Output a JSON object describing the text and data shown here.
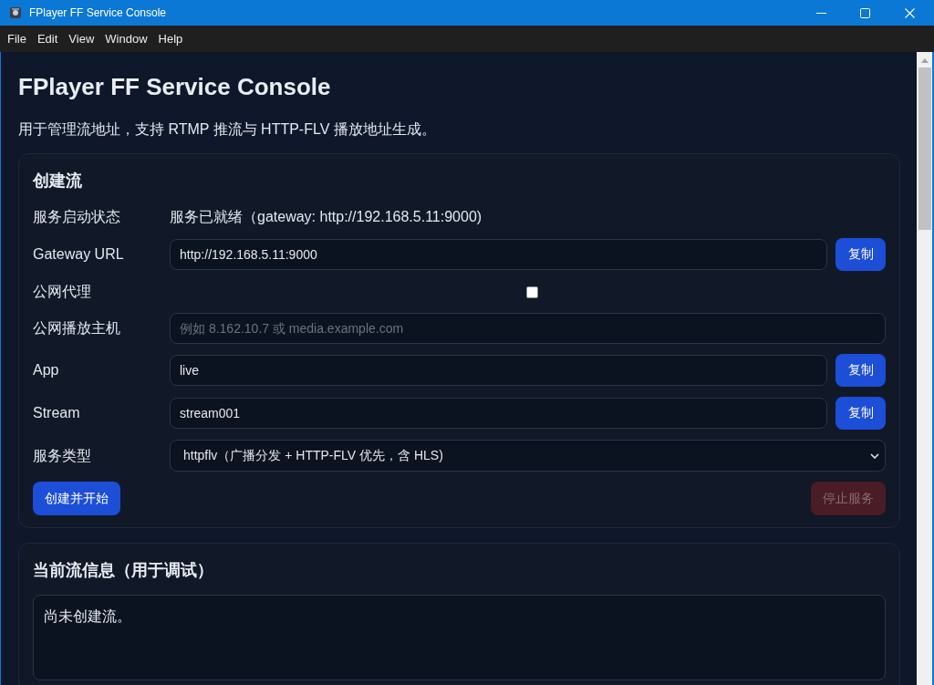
{
  "window": {
    "title": "FPlayer FF Service Console"
  },
  "menu_bar": [
    "File",
    "Edit",
    "View",
    "Window",
    "Help"
  ],
  "page": {
    "title": "FPlayer FF Service Console",
    "subtitle": "用于管理流地址，支持 RTMP 推流与 HTTP-FLV 播放地址生成。"
  },
  "create_card": {
    "heading": "创建流",
    "rows": [
      {
        "kind": "status",
        "label": "服务启动状态",
        "value": "服务已就绪（gateway: http://192.168.5.11:9000)"
      },
      {
        "kind": "input",
        "label": "Gateway URL",
        "value": "http://192.168.5.11:9000",
        "copy_button": "复制"
      },
      {
        "kind": "checkbox",
        "label": "公网代理",
        "checked": false
      },
      {
        "kind": "input",
        "label": "公网播放主机",
        "placeholder": "例如 8.162.10.7 或 media.example.com"
      },
      {
        "kind": "input",
        "label": "App",
        "value": "live",
        "copy_button": "复制"
      },
      {
        "kind": "input",
        "label": "Stream",
        "value": "stream001",
        "copy_button": "复制"
      },
      {
        "kind": "select",
        "label": "服务类型",
        "value": "httpflv（广播分发 + HTTP-FLV 优先，含 HLS)"
      }
    ],
    "actions": [
      {
        "kind": "primary",
        "label": "创建并开始",
        "disabled": false
      },
      {
        "kind": "danger",
        "label": "停止服务",
        "disabled": true
      }
    ]
  },
  "info_card": {
    "heading": "当前流信息（用于调试）",
    "output": "尚未创建流。"
  }
}
